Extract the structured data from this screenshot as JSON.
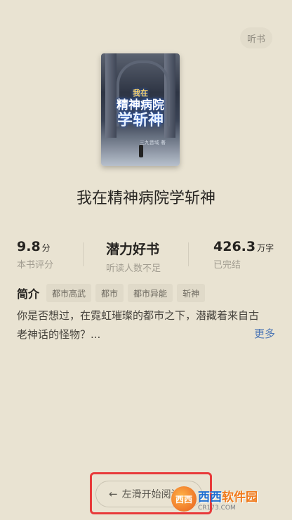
{
  "header": {
    "listen_label": "听书"
  },
  "book": {
    "cover_text_small": "我在",
    "cover_text_mid": "精神病院",
    "cover_text_big": "学斩神",
    "cover_author": "三九音域 著",
    "title": "我在精神病院学斩神"
  },
  "stats": [
    {
      "value": "9.8",
      "unit": "分",
      "label": "本书评分"
    },
    {
      "value": "潜力好书",
      "unit": "",
      "label": "听读人数不足"
    },
    {
      "value": "426.3",
      "unit": "万字",
      "label": "已完结"
    }
  ],
  "intro": {
    "label": "简介",
    "tags": [
      "都市高武",
      "都市",
      "都市异能",
      "斩神"
    ],
    "text": "你是否想过，在霓虹璀璨的都市之下，潜藏着来自古老神话的怪物？...",
    "more_label": "更多"
  },
  "footer": {
    "swipe_label": "左滑开始阅读"
  },
  "watermark": {
    "part1": "西西",
    "part2": "软件园",
    "sub": "CR173.COM",
    "badge": "西西"
  }
}
